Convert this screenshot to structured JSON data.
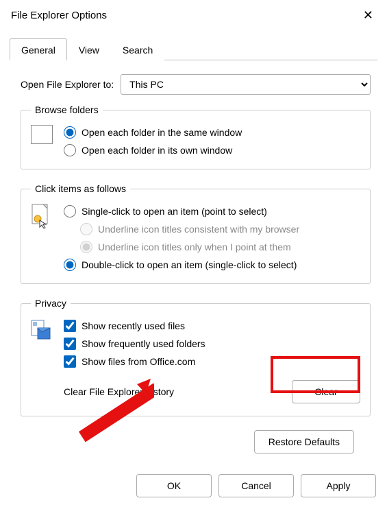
{
  "window": {
    "title": "File Explorer Options",
    "close_label": "✕"
  },
  "tabs": [
    {
      "label": "General"
    },
    {
      "label": "View"
    },
    {
      "label": "Search"
    }
  ],
  "activeTab": "General",
  "openExplorer": {
    "label": "Open File Explorer to:",
    "selected": "This PC"
  },
  "browseFolders": {
    "legend": "Browse folders",
    "options": [
      {
        "label": "Open each folder in the same window",
        "checked": true
      },
      {
        "label": "Open each folder in its own window",
        "checked": false
      }
    ]
  },
  "clickItems": {
    "legend": "Click items as follows",
    "single": {
      "label": "Single-click to open an item (point to select)",
      "checked": false,
      "subs": [
        {
          "label": "Underline icon titles consistent with my browser",
          "checked": false
        },
        {
          "label": "Underline icon titles only when I point at them",
          "checked": true
        }
      ]
    },
    "double": {
      "label": "Double-click to open an item (single-click to select)",
      "checked": true
    }
  },
  "privacy": {
    "legend": "Privacy",
    "options": [
      {
        "label": "Show recently used files",
        "checked": true
      },
      {
        "label": "Show frequently used folders",
        "checked": true
      },
      {
        "label": "Show files from Office.com",
        "checked": true
      }
    ],
    "clear_label": "Clear File Explorer history",
    "clear_button": "Clear"
  },
  "restore_button": "Restore Defaults",
  "footer": {
    "ok": "OK",
    "cancel": "Cancel",
    "apply": "Apply"
  }
}
